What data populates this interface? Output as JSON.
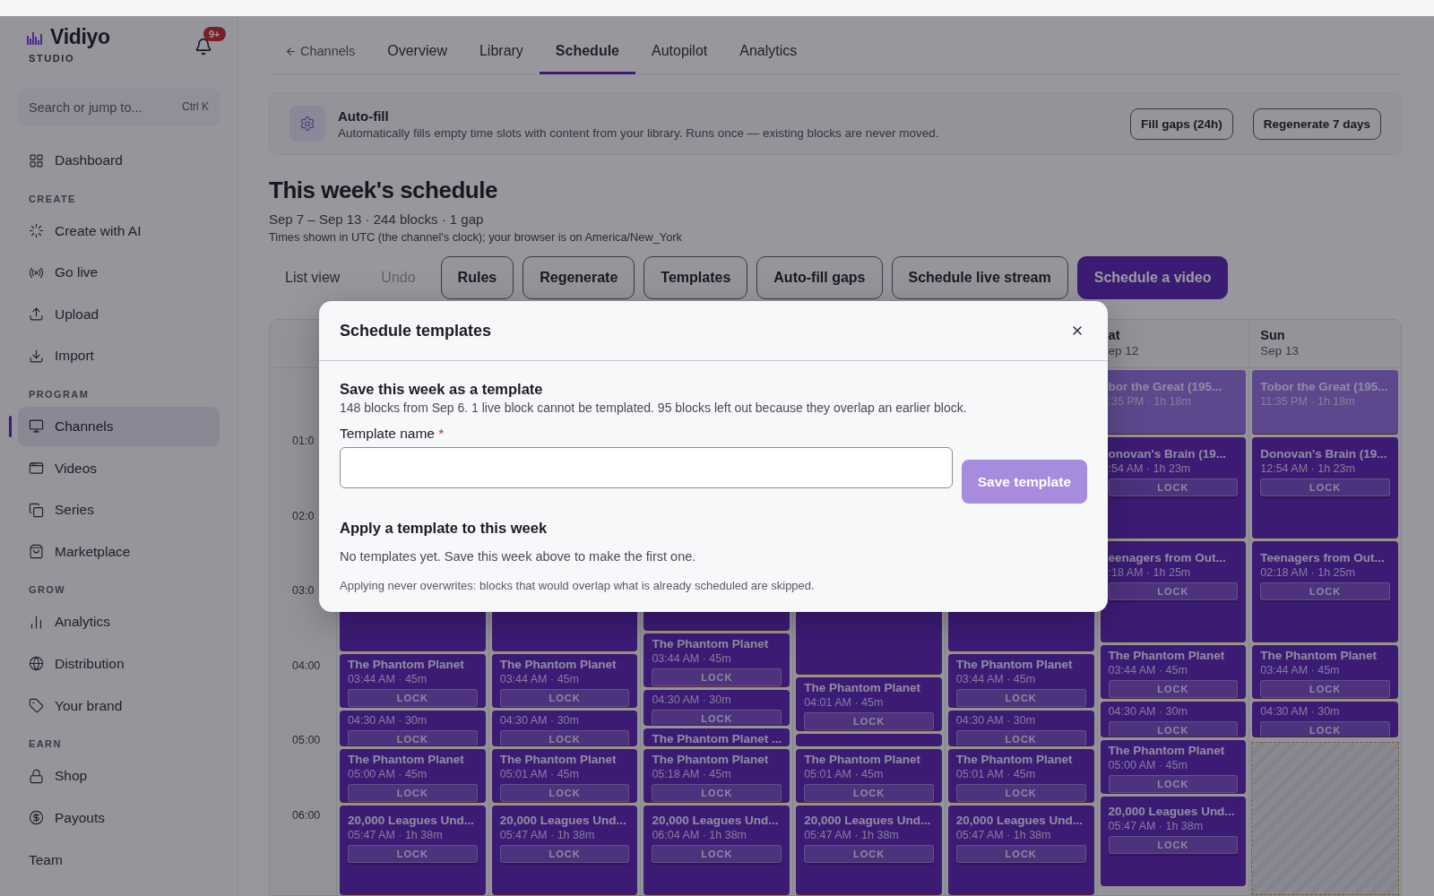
{
  "sidebar": {
    "brand": "Vidiyo",
    "subtitle": "STUDIO",
    "notification_badge": "9+",
    "search": {
      "placeholder": "Search or jump to...",
      "shortcut": "Ctrl K"
    },
    "nav": [
      {
        "kind": "item",
        "label": "Dashboard",
        "selected": false
      },
      {
        "kind": "heading",
        "label": "CREATE"
      },
      {
        "kind": "item",
        "label": "Create with AI",
        "selected": false
      },
      {
        "kind": "item",
        "label": "Go live",
        "selected": false
      },
      {
        "kind": "item",
        "label": "Upload",
        "selected": false
      },
      {
        "kind": "item",
        "label": "Import",
        "selected": false
      },
      {
        "kind": "heading",
        "label": "PROGRAM"
      },
      {
        "kind": "item",
        "label": "Channels",
        "selected": true
      },
      {
        "kind": "item",
        "label": "Videos",
        "selected": false
      },
      {
        "kind": "item",
        "label": "Series",
        "selected": false
      },
      {
        "kind": "item",
        "label": "Marketplace",
        "selected": false
      },
      {
        "kind": "heading",
        "label": "GROW"
      },
      {
        "kind": "item",
        "label": "Analytics",
        "selected": false
      },
      {
        "kind": "item",
        "label": "Distribution",
        "selected": false
      },
      {
        "kind": "item",
        "label": "Your brand",
        "selected": false
      },
      {
        "kind": "heading",
        "label": "EARN"
      },
      {
        "kind": "item",
        "label": "Shop",
        "selected": false
      },
      {
        "kind": "item",
        "label": "Payouts",
        "selected": false
      },
      {
        "kind": "footer",
        "label": "Team"
      }
    ]
  },
  "tabs": [
    {
      "kind": "back",
      "label": "Channels",
      "selected": false
    },
    {
      "kind": "tab",
      "label": "Overview",
      "selected": false
    },
    {
      "kind": "tab",
      "label": "Library",
      "selected": false
    },
    {
      "kind": "tab",
      "label": "Schedule",
      "selected": true
    },
    {
      "kind": "tab",
      "label": "Autopilot",
      "selected": false
    },
    {
      "kind": "tab",
      "label": "Analytics",
      "selected": false
    }
  ],
  "autofill": {
    "title": "Auto-fill",
    "description": "Automatically fills empty time slots with content from your library. Runs once — existing blocks are never moved.",
    "buttons": [
      "Fill gaps (24h)",
      "Regenerate 7 days"
    ]
  },
  "schedule": {
    "title": "This week's schedule",
    "summary": "Sep 7 – Sep 13 · 244 blocks · 1 gap",
    "timezone_note": "Times shown in UTC (the channel's clock); your browser is on America/New_York"
  },
  "toolbar": [
    {
      "kind": "text",
      "label": "List view",
      "disabled": false
    },
    {
      "kind": "text",
      "label": "Undo",
      "disabled": true
    },
    {
      "kind": "outline",
      "label": "Rules",
      "disabled": false
    },
    {
      "kind": "outline",
      "label": "Regenerate",
      "disabled": false
    },
    {
      "kind": "outline",
      "label": "Templates",
      "disabled": false
    },
    {
      "kind": "outline",
      "label": "Auto-fill gaps",
      "disabled": false
    },
    {
      "kind": "outline",
      "label": "Schedule live stream",
      "disabled": false
    },
    {
      "kind": "primary",
      "label": "Schedule a video",
      "disabled": false
    }
  ],
  "calendar": {
    "time_labels": [
      "01:0",
      "02:0",
      "03:0",
      "04:00",
      "05:00",
      "06:00"
    ],
    "days": [
      {
        "blocks": [
          {
            "kind": "hidden"
          },
          {
            "kind": "event",
            "title": "The Phantom Planet",
            "time": "03:44 AM · 45m",
            "lock": "LOCK"
          },
          {
            "kind": "slot",
            "time": "04:30 AM · 30m",
            "lock": "LOCK"
          },
          {
            "kind": "event",
            "title": "The Phantom Planet",
            "time": "05:00 AM · 45m",
            "lock": "LOCK"
          },
          {
            "kind": "feature",
            "title": "20,000 Leagues Und...",
            "time": "05:47 AM · 1h 38m",
            "lock": "LOCK"
          }
        ]
      },
      {
        "blocks": [
          {
            "kind": "hidden"
          },
          {
            "kind": "event",
            "title": "The Phantom Planet",
            "time": "03:44 AM · 45m",
            "lock": "LOCK"
          },
          {
            "kind": "slot",
            "time": "04:30 AM · 30m",
            "lock": "LOCK"
          },
          {
            "kind": "event",
            "title": "The Phantom Planet",
            "time": "05:01 AM · 45m",
            "lock": "LOCK"
          },
          {
            "kind": "feature",
            "title": "20,000 Leagues Und...",
            "time": "05:47 AM · 1h 38m",
            "lock": "LOCK"
          }
        ]
      },
      {
        "blocks": [
          {
            "kind": "hidden"
          },
          {
            "kind": "event",
            "title": "The Phantom Planet",
            "time": "03:44 AM · 45m",
            "lock": "LOCK"
          },
          {
            "kind": "slot",
            "time": "04:30 AM · 30m",
            "lock": "LOCK"
          },
          {
            "kind": "stub",
            "title": "The Phantom Planet ..."
          },
          {
            "kind": "event",
            "title": "The Phantom Planet",
            "time": "05:18 AM · 45m",
            "lock": "LOCK"
          },
          {
            "kind": "feature",
            "title": "20,000 Leagues Und...",
            "time": "06:04 AM · 1h 38m",
            "lock": "LOCK"
          }
        ]
      },
      {
        "blocks": [
          {
            "kind": "hidden"
          },
          {
            "kind": "event",
            "title": "The Phantom Planet",
            "time": "04:01 AM · 45m",
            "lock": "LOCK"
          },
          {
            "kind": "empty"
          },
          {
            "kind": "event",
            "title": "The Phantom Planet",
            "time": "05:01 AM · 45m",
            "lock": "LOCK"
          },
          {
            "kind": "feature",
            "title": "20,000 Leagues Und...",
            "time": "05:47 AM · 1h 38m",
            "lock": "LOCK"
          }
        ]
      },
      {
        "blocks": [
          {
            "kind": "hidden"
          },
          {
            "kind": "event",
            "title": "The Phantom Planet",
            "time": "03:44 AM · 45m",
            "lock": "LOCK"
          },
          {
            "kind": "slot",
            "time": "04:30 AM · 30m",
            "lock": "LOCK"
          },
          {
            "kind": "event",
            "title": "The Phantom Planet",
            "time": "05:01 AM · 45m",
            "lock": "LOCK"
          },
          {
            "kind": "feature",
            "title": "20,000 Leagues Und...",
            "time": "05:47 AM · 1h 38m",
            "lock": "LOCK"
          }
        ]
      },
      {
        "name": "at",
        "date": "ep 12",
        "blocks": [
          {
            "kind": "past",
            "title": "bor the Great (195...",
            "time": ":35 PM · 1h 18m"
          },
          {
            "kind": "long",
            "title": "onovan's Brain (19...",
            "time": ":54 AM · 1h 23m",
            "lock": "LOCK"
          },
          {
            "kind": "long",
            "title": "eenagers from Out...",
            "time": ":18 AM · 1h 25m",
            "lock": "LOCK"
          },
          {
            "kind": "event",
            "title": "The Phantom Planet",
            "time": "03:44 AM · 45m",
            "lock": "LOCK"
          },
          {
            "kind": "slot",
            "time": "04:30 AM · 30m",
            "lock": "LOCK"
          },
          {
            "kind": "event",
            "title": "The Phantom Planet",
            "time": "05:00 AM · 45m",
            "lock": "LOCK"
          },
          {
            "kind": "feature",
            "title": "20,000 Leagues Und...",
            "time": "05:47 AM · 1h 38m",
            "lock": "LOCK"
          }
        ]
      },
      {
        "name": "Sun",
        "date": "Sep 13",
        "blocks": [
          {
            "kind": "past",
            "title": "Tobor the Great (195...",
            "time": "11:35 PM · 1h 18m"
          },
          {
            "kind": "long",
            "title": "Donovan's Brain (19...",
            "time": "12:54 AM · 1h 23m",
            "lock": "LOCK"
          },
          {
            "kind": "long",
            "title": "Teenagers from Out...",
            "time": "02:18 AM · 1h 25m",
            "lock": "LOCK"
          },
          {
            "kind": "event",
            "title": "The Phantom Planet",
            "time": "03:44 AM · 45m",
            "lock": "LOCK"
          },
          {
            "kind": "slot",
            "time": "04:30 AM · 30m",
            "lock": "LOCK"
          },
          {
            "kind": "gap"
          }
        ]
      }
    ]
  },
  "dialog": {
    "title": "Schedule templates",
    "save_section": {
      "title": "Save this week as a template",
      "description": "148 blocks from Sep 6. 1 live block cannot be templated. 95 blocks left out because they overlap an earlier block.",
      "field_label": "Template name",
      "required_mark": "*",
      "button": "Save template",
      "button_disabled": true
    },
    "apply_section": {
      "title": "Apply a template to this week",
      "empty_text": "No templates yet. Save this week above to make the first one.",
      "note": "Applying never overwrites: blocks that would overlap what is already scheduled are skipped."
    }
  }
}
